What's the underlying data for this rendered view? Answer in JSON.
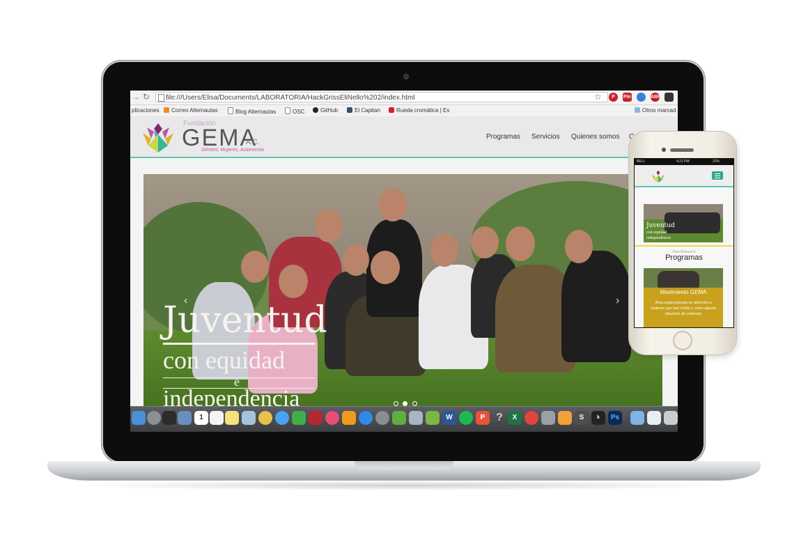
{
  "browser": {
    "url": "file:///Users/Elisa/Documents/LABORATORIA/HackGrissEliNello%202/index.html",
    "bookmarks": [
      "plicaciones",
      "Correo Alternautas",
      "Blog Alternautas",
      "OSC",
      "GitHub",
      "El Capitan",
      "Rueda cromática",
      "Es",
      "Otros marcad"
    ],
    "extensions": [
      "P",
      "Pin",
      "ABP"
    ]
  },
  "site": {
    "logo_prefix": "Fundación",
    "logo_name": "GEMA",
    "logo_suffix": "A.C.",
    "logo_tagline": "Género, Mujeres, Autonomía",
    "menu": [
      "Programas",
      "Servicios",
      "Quienes somos",
      "Co"
    ],
    "hero_line1": "Juventud",
    "hero_line2": "con equidad",
    "hero_line3": "e",
    "hero_line4": "independencia",
    "arrow_left": "‹",
    "arrow_right": "›"
  },
  "phone": {
    "carrier": "BELL",
    "time": "4:21 PM",
    "battery": "22%",
    "kicker": "Free Resource",
    "section_title": "Programas",
    "card_title": "Movimiento GEMA",
    "card_text": "Área especializada en atención a mujeres que han vivido o viven alguna situación de violencia"
  },
  "dock": {
    "icons": [
      "finder-icon",
      "launchpad-icon",
      "activity-icon",
      "preview-icon",
      "calendar-icon",
      "reminders-icon",
      "notes-icon",
      "mail-icon",
      "photos-icon",
      "messages-icon",
      "facetime-icon",
      "photobooth-icon",
      "itunes-icon",
      "ibooks-icon",
      "appstore-icon",
      "preferences-icon",
      "evernote-icon",
      "preview2-icon",
      "android-icon",
      "word-icon",
      "spotify-icon",
      "p-icon",
      "help-icon",
      "excel-icon",
      "chrome-icon",
      "diskutil-icon",
      "calculator-icon",
      "sublime-icon",
      "kindle-icon",
      "photoshop-icon",
      "folder-icon",
      "document-icon",
      "trash-icon"
    ]
  },
  "colors": {
    "accent_teal": "#63c5b5",
    "menu_green": "#2ea88f",
    "card_yellow": "#d4a518"
  }
}
